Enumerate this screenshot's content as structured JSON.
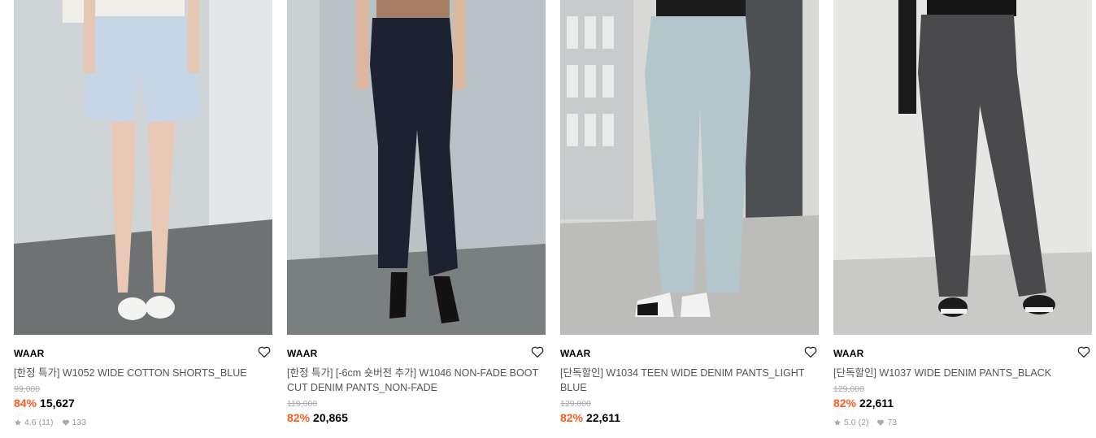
{
  "products": [
    {
      "brand": "WAAR",
      "title": "[한정 특가] W1052 WIDE COTTON SHORTS_BLUE",
      "original_price": "99,000",
      "discount": "84%",
      "price": "15,627",
      "rating": "4.6",
      "reviews": "(11)",
      "likes": "133",
      "image_desc": "light-blue-cotton-shorts",
      "colors": {
        "bg": "#cfd4d6",
        "floor": "#6e7273",
        "item": "#c6d6e6"
      }
    },
    {
      "brand": "WAAR",
      "title": "[한정 특가] [-6cm 숏버전 추가] W1046 NON-FADE BOOT CUT DENIM PANTS_NON-FADE",
      "original_price": "119,000",
      "discount": "82%",
      "price": "20,865",
      "image_desc": "dark-bootcut-denim",
      "colors": {
        "bg": "#b9c2c4",
        "floor": "#7a7f80",
        "item": "#1d2230"
      }
    },
    {
      "brand": "WAAR",
      "title": "[단독할인] W1034 TEEN WIDE DENIM PANTS_LIGHT BLUE",
      "original_price": "129,000",
      "discount": "82%",
      "price": "22,611",
      "image_desc": "light-blue-wide-denim",
      "colors": {
        "bg": "#d8d8d6",
        "floor": "#bcbcba",
        "item": "#b3c6cc"
      }
    },
    {
      "brand": "WAAR",
      "title": "[단독할인] W1037 WIDE DENIM PANTS_BLACK",
      "original_price": "129,000",
      "discount": "82%",
      "price": "22,611",
      "rating": "5.0",
      "reviews": "(2)",
      "likes": "73",
      "image_desc": "black-wide-denim",
      "colors": {
        "bg": "#e6e6e4",
        "floor": "#c9c9c7",
        "item": "#4a4a4c"
      }
    }
  ]
}
